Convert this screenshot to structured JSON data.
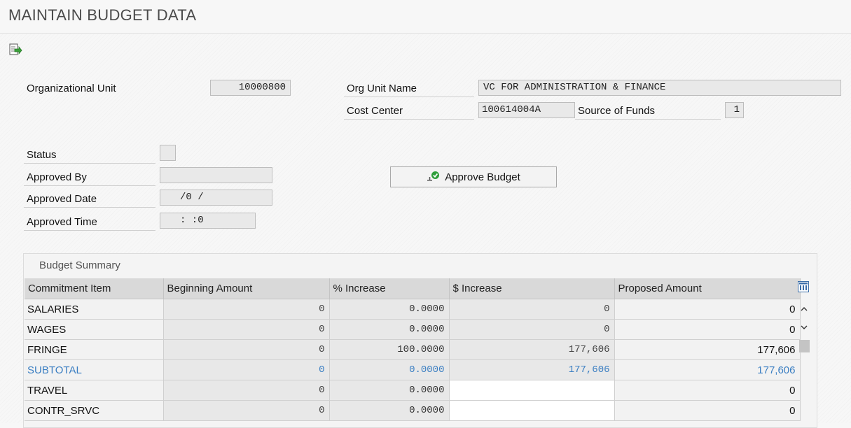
{
  "page": {
    "title": "MAINTAIN BUDGET DATA"
  },
  "toolbar": {
    "execute_icon": "execute-icon"
  },
  "header": {
    "org_unit_label": "Organizational Unit",
    "org_unit_value": "10000800",
    "org_unit_name_label": "Org Unit Name",
    "org_unit_name_value": "VC FOR ADMINISTRATION & FINANCE",
    "cost_center_label": "Cost Center",
    "cost_center_value": "100614004A",
    "source_of_funds_label": "Source of Funds",
    "source_of_funds_value": "1"
  },
  "approval": {
    "status_label": "Status",
    "status_value": "",
    "approved_by_label": "Approved By",
    "approved_by_value": "",
    "approved_date_label": "Approved Date",
    "approved_date_value": "/0 /",
    "approved_time_label": "Approved Time",
    "approved_time_value": ":  :0",
    "approve_button_label": "Approve Budget"
  },
  "summary": {
    "panel_title": "Budget Summary",
    "columns": [
      "Commitment Item",
      "Beginning Amount",
      "% Increase",
      "$ Increase",
      "Proposed Amount"
    ],
    "rows": [
      {
        "item": "SALARIES",
        "beginning": "0",
        "pct": "0.0000",
        "inc": "0",
        "proposed": "0"
      },
      {
        "item": "WAGES",
        "beginning": "0",
        "pct": "0.0000",
        "inc": "0",
        "proposed": "0"
      },
      {
        "item": "FRINGE",
        "beginning": "0",
        "pct": "100.0000",
        "inc": "177,606",
        "proposed": "177,606"
      },
      {
        "item": "SUBTOTAL",
        "beginning": "0",
        "pct": "0.0000",
        "inc": "177,606",
        "proposed": "177,606"
      },
      {
        "item": "TRAVEL",
        "beginning": "0",
        "pct": "0.0000",
        "inc": "",
        "proposed": "0"
      },
      {
        "item": "CONTR_SRVC",
        "beginning": "0",
        "pct": "0.0000",
        "inc": "",
        "proposed": "0"
      }
    ]
  },
  "colors": {
    "subtotal_text": "#3a7ec2",
    "check_green": "#2e9e3a",
    "header_bg": "#d9d9d9"
  }
}
